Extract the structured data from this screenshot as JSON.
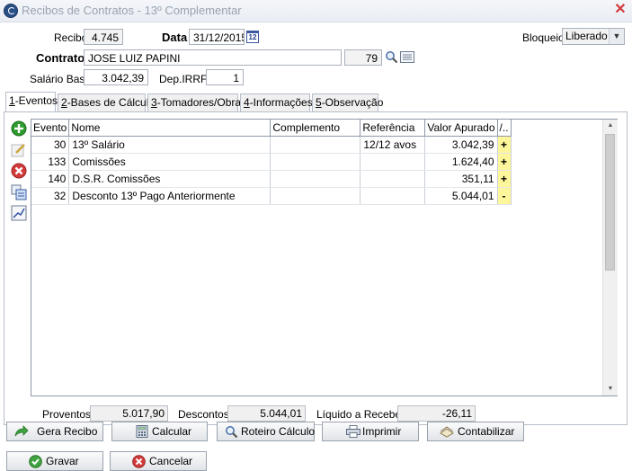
{
  "window": {
    "title": "Recibos de Contratos - 13º Complementar",
    "close": "✕"
  },
  "header": {
    "recibo_label": "Recibo",
    "recibo_value": "4.745",
    "data_label": "Data",
    "data_value": "31/12/2015",
    "calendar_text": "12",
    "bloqueio_label": "Bloqueio",
    "bloqueio_value": "Liberado",
    "contrato_label": "Contrato",
    "contrato_name": "JOSE LUIZ PAPINI",
    "contrato_code": "79",
    "salario_label": "Salário Base",
    "salario_value": "3.042,39",
    "dep_label": "Dep.IRRF",
    "dep_value": "1"
  },
  "tabs": [
    {
      "key": "1",
      "label": "-Eventos"
    },
    {
      "key": "2",
      "label": "-Bases de Cálculo"
    },
    {
      "key": "3",
      "label": "-Tomadores/Obras"
    },
    {
      "key": "4",
      "label": "-Informações"
    },
    {
      "key": "5",
      "label": "-Observação"
    }
  ],
  "grid": {
    "columns": [
      "Evento",
      "Nome",
      "Complemento",
      "Referência",
      "Valor Apurado",
      "/.."
    ],
    "rows": [
      {
        "evento": "30",
        "nome": "13º Salário",
        "complemento": "",
        "referencia": "12/12 avos",
        "valor": "3.042,39",
        "flag": "+"
      },
      {
        "evento": "133",
        "nome": "Comissões",
        "complemento": "",
        "referencia": "",
        "valor": "1.624,40",
        "flag": "+"
      },
      {
        "evento": "140",
        "nome": "D.S.R. Comissões",
        "complemento": "",
        "referencia": "",
        "valor": "351,11",
        "flag": "+"
      },
      {
        "evento": "32",
        "nome": "Desconto 13º Pago Anteriormente",
        "complemento": "",
        "referencia": "",
        "valor": "5.044,01",
        "flag": "-"
      }
    ]
  },
  "totals": {
    "proventos_label": "Proventos",
    "proventos_value": "5.017,90",
    "descontos_label": "Descontos",
    "descontos_value": "5.044,01",
    "liquido_label": "Líquido a Receber",
    "liquido_value": "-26,11"
  },
  "buttons": {
    "gera_recibo": "Gera Recibo",
    "calcular": "Calcular",
    "roteiro": "Roteiro Cálculo",
    "imprimir": "Imprimir",
    "contabilizar": "Contabilizar",
    "gravar": "Gravar",
    "cancelar": "Cancelar"
  },
  "colors": {
    "flag_bg": "#fdf69a",
    "add_green": "#2e9a2e",
    "delete_red": "#d23b3b",
    "accent_blue": "#3b5aa0"
  }
}
